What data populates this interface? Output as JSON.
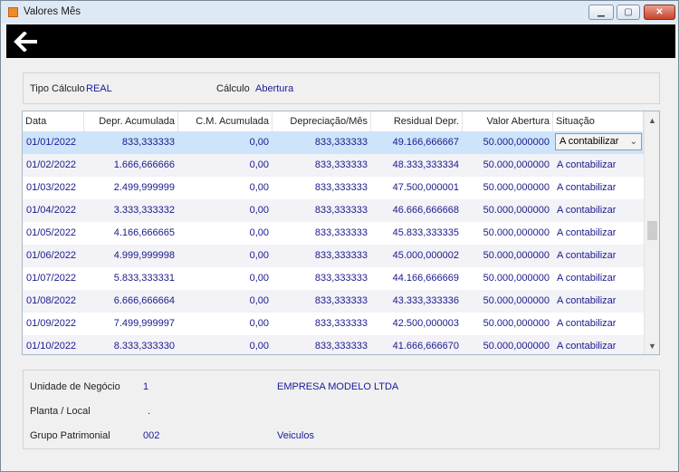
{
  "window": {
    "title": "Valores Mês",
    "buttons": {
      "minimize": "▁",
      "maximize": "▢",
      "close": "✕"
    }
  },
  "toolbar": {
    "back_icon": "back-arrow-icon"
  },
  "calc": {
    "tipo_label": "Tipo Cálculo",
    "tipo_value": "REAL",
    "calculo_label": "Cálculo",
    "calculo_value": "Abertura"
  },
  "grid": {
    "headers": [
      "Data",
      "Depr. Acumulada",
      "C.M. Acumulada",
      "Depreciação/Mês",
      "Residual Depr.",
      "Valor Abertura",
      "Situação"
    ],
    "rows": [
      [
        "01/01/2022",
        "833,333333",
        "0,00",
        "833,333333",
        "49.166,666667",
        "50.000,000000",
        "A contabilizar"
      ],
      [
        "01/02/2022",
        "1.666,666666",
        "0,00",
        "833,333333",
        "48.333,333334",
        "50.000,000000",
        "A contabilizar"
      ],
      [
        "01/03/2022",
        "2.499,999999",
        "0,00",
        "833,333333",
        "47.500,000001",
        "50.000,000000",
        "A contabilizar"
      ],
      [
        "01/04/2022",
        "3.333,333332",
        "0,00",
        "833,333333",
        "46.666,666668",
        "50.000,000000",
        "A contabilizar"
      ],
      [
        "01/05/2022",
        "4.166,666665",
        "0,00",
        "833,333333",
        "45.833,333335",
        "50.000,000000",
        "A contabilizar"
      ],
      [
        "01/06/2022",
        "4.999,999998",
        "0,00",
        "833,333333",
        "45.000,000002",
        "50.000,000000",
        "A contabilizar"
      ],
      [
        "01/07/2022",
        "5.833,333331",
        "0,00",
        "833,333333",
        "44.166,666669",
        "50.000,000000",
        "A contabilizar"
      ],
      [
        "01/08/2022",
        "6.666,666664",
        "0,00",
        "833,333333",
        "43.333,333336",
        "50.000,000000",
        "A contabilizar"
      ],
      [
        "01/09/2022",
        "7.499,999997",
        "0,00",
        "833,333333",
        "42.500,000003",
        "50.000,000000",
        "A contabilizar"
      ],
      [
        "01/10/2022",
        "8.333,333330",
        "0,00",
        "833,333333",
        "41.666,666670",
        "50.000,000000",
        "A contabilizar"
      ]
    ],
    "selected_row": 0,
    "scroll_up": "▲",
    "scroll_down": "▼"
  },
  "info": {
    "unidade_label": "Unidade de Negócio",
    "unidade_code": "1",
    "unidade_name": "EMPRESA MODELO LTDA",
    "planta_label": "Planta / Local",
    "planta_code": ".",
    "grupo_label": "Grupo Patrimonial",
    "grupo_code": "002",
    "grupo_name": "Veiculos"
  },
  "colors": {
    "accent_blue": "#1a1a9c",
    "selected_row": "#cde4fb",
    "toolbar": "#000000"
  }
}
